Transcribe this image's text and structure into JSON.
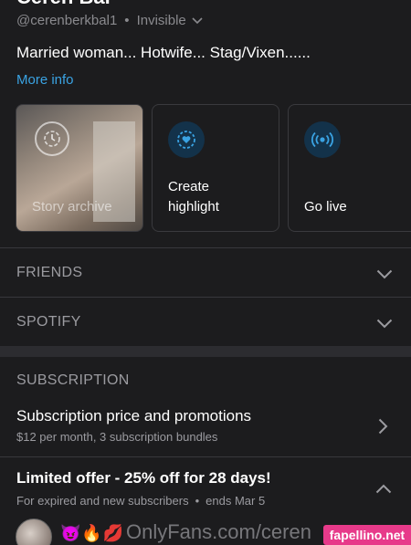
{
  "profile": {
    "name": "Ceren Bal",
    "handle": "@cerenberkbal1",
    "status": "Invisible",
    "bio": "Married woman... Hotwife... Stag/Vixen......",
    "more_info": "More info"
  },
  "tiles": {
    "story_archive": "Story archive",
    "create_highlight_line1": "Create",
    "create_highlight_line2": "highlight",
    "go_live": "Go live"
  },
  "sections": {
    "friends": "FRIENDS",
    "spotify": "SPOTIFY",
    "subscription": "SUBSCRIPTION"
  },
  "subscription": {
    "price_title": "Subscription price and promotions",
    "price_sub": "$12 per month, 3 subscription bundles",
    "offer_title": "Limited offer - 25% off for 28 days!",
    "offer_for": "For expired and new subscribers",
    "offer_ends": "ends Mar 5"
  },
  "post": {
    "emojis": "😈🔥💋",
    "link_text": "OnlyFans.com/ceren"
  },
  "watermark": "fapellino.net",
  "colors": {
    "accent_blue": "#3aa3e3",
    "background": "#1c1c1e",
    "watermark_pink": "#e73a8a"
  },
  "icons": [
    "chevron-down-icon",
    "story-archive-icon",
    "heart-circle-icon",
    "live-broadcast-icon",
    "chevron-right-icon",
    "chevron-up-icon"
  ]
}
